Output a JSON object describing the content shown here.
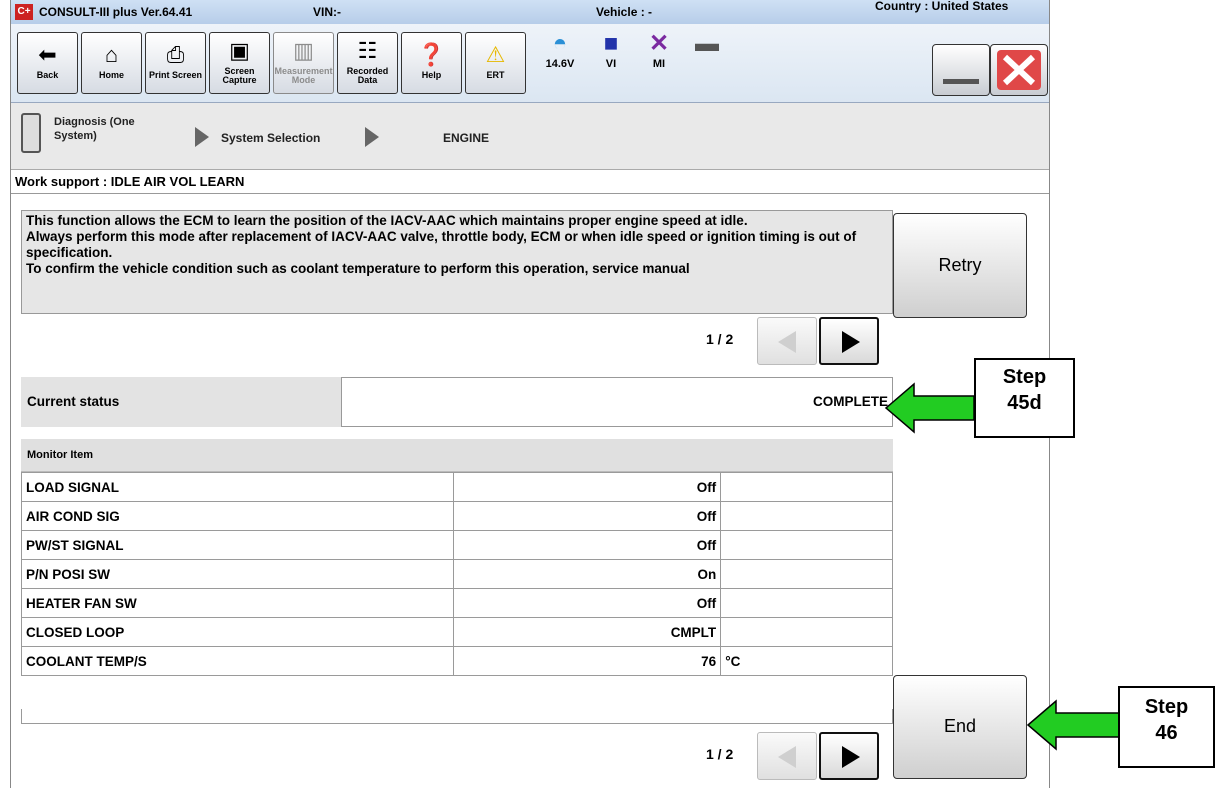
{
  "titlebar": {
    "logo": "C+",
    "app": "CONSULT-III plus  Ver.64.41",
    "vin": "VIN:-",
    "vehicle": "Vehicle : -",
    "country": "Country : United States"
  },
  "toolbar": {
    "back": "Back",
    "home": "Home",
    "print_screen": "Print Screen",
    "screen_capture": "Screen Capture",
    "measurement_mode": "Measurement Mode",
    "recorded_data": "Recorded Data",
    "help": "Help",
    "ert": "ERT",
    "battery_voltage": "14.6V",
    "vi": "VI",
    "mi": "MI"
  },
  "breadcrumb": {
    "item1": "Diagnosis (One System)",
    "item2": "System Selection",
    "item3": "ENGINE"
  },
  "work_support_title": "Work support : IDLE AIR VOL LEARN",
  "description": {
    "line1": "This function allows the ECM to learn the position of the IACV-AAC which maintains proper engine speed at idle.",
    "line2": "Always perform this mode after replacement of IACV-AAC valve, throttle body, ECM or when idle speed or ignition timing is out of specification.",
    "line3": "To confirm the vehicle condition such as coolant temperature to perform this operation, service manual"
  },
  "buttons": {
    "retry": "Retry",
    "end": "End"
  },
  "pager_top": "1 / 2",
  "pager_bottom": "1 / 2",
  "current_status": {
    "label": "Current status",
    "value": "COMPLETE"
  },
  "monitor": {
    "header": "Monitor Item",
    "rows": [
      {
        "name": "LOAD SIGNAL",
        "value": "Off",
        "unit": ""
      },
      {
        "name": "AIR COND SIG",
        "value": "Off",
        "unit": ""
      },
      {
        "name": "PW/ST SIGNAL",
        "value": "Off",
        "unit": ""
      },
      {
        "name": "P/N POSI SW",
        "value": "On",
        "unit": ""
      },
      {
        "name": "HEATER FAN SW",
        "value": "Off",
        "unit": ""
      },
      {
        "name": "CLOSED LOOP",
        "value": "CMPLT",
        "unit": ""
      },
      {
        "name": "COOLANT TEMP/S",
        "value": "76",
        "unit": "°C"
      }
    ]
  },
  "callouts": {
    "step1_line1": "Step",
    "step1_line2": "45d",
    "step2_line1": "Step",
    "step2_line2": "46"
  },
  "colors": {
    "arrow": "#22cc22",
    "titlebar": "#b7cde9"
  }
}
